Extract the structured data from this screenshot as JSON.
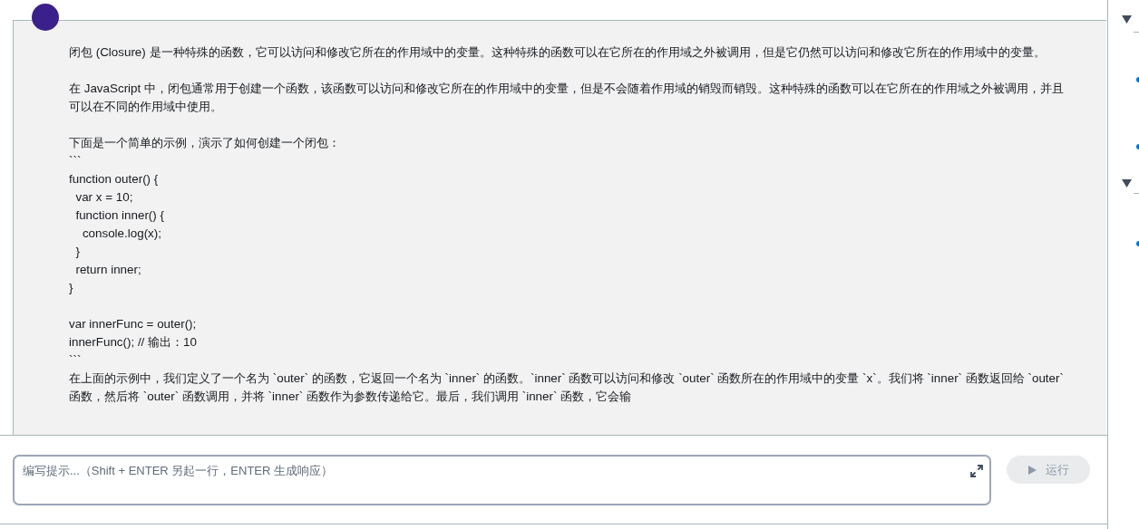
{
  "message": {
    "blocks": [
      {
        "kind": "text",
        "text": "闭包 (Closure) 是一种特殊的函数，它可以访问和修改它所在的作用域中的变量。这种特殊的函数可以在它所在的作用域之外被调用，但是它仍然可以访问和修改它所在的作用域中的变量。"
      },
      {
        "kind": "text",
        "text": "在 JavaScript 中，闭包通常用于创建一个函数，该函数可以访问和修改它所在的作用域中的变量，但是不会随着作用域的销毁而销毁。这种特殊的函数可以在它所在的作用域之外被调用，并且可以在不同的作用域中使用。"
      },
      {
        "kind": "code",
        "text": "下面是一个简单的示例，演示了如何创建一个闭包：\n```\nfunction outer() {\n  var x = 10;\n  function inner() {\n    console.log(x);\n  }\n  return inner;\n}\n\nvar innerFunc = outer();\ninnerFunc(); // 输出：10\n```\n在上面的示例中，我们定义了一个名为 `outer` 的函数，它返回一个名为 `inner` 的函数。`inner` 函数可以访问和修改 `outer` 函数所在的作用域中的变量 `x`。我们将 `inner` 函数返回给 `outer` 函数，然后将 `outer` 函数调用，并将 `inner` 函数作为参数传递给它。最后，我们调用 `inner` 函数，它会输"
      }
    ]
  },
  "prompt": {
    "placeholder": "编写提示...（Shift + ENTER 另起一行，ENTER 生成响应）"
  },
  "run_button": {
    "label": "运行",
    "disabled": true
  }
}
